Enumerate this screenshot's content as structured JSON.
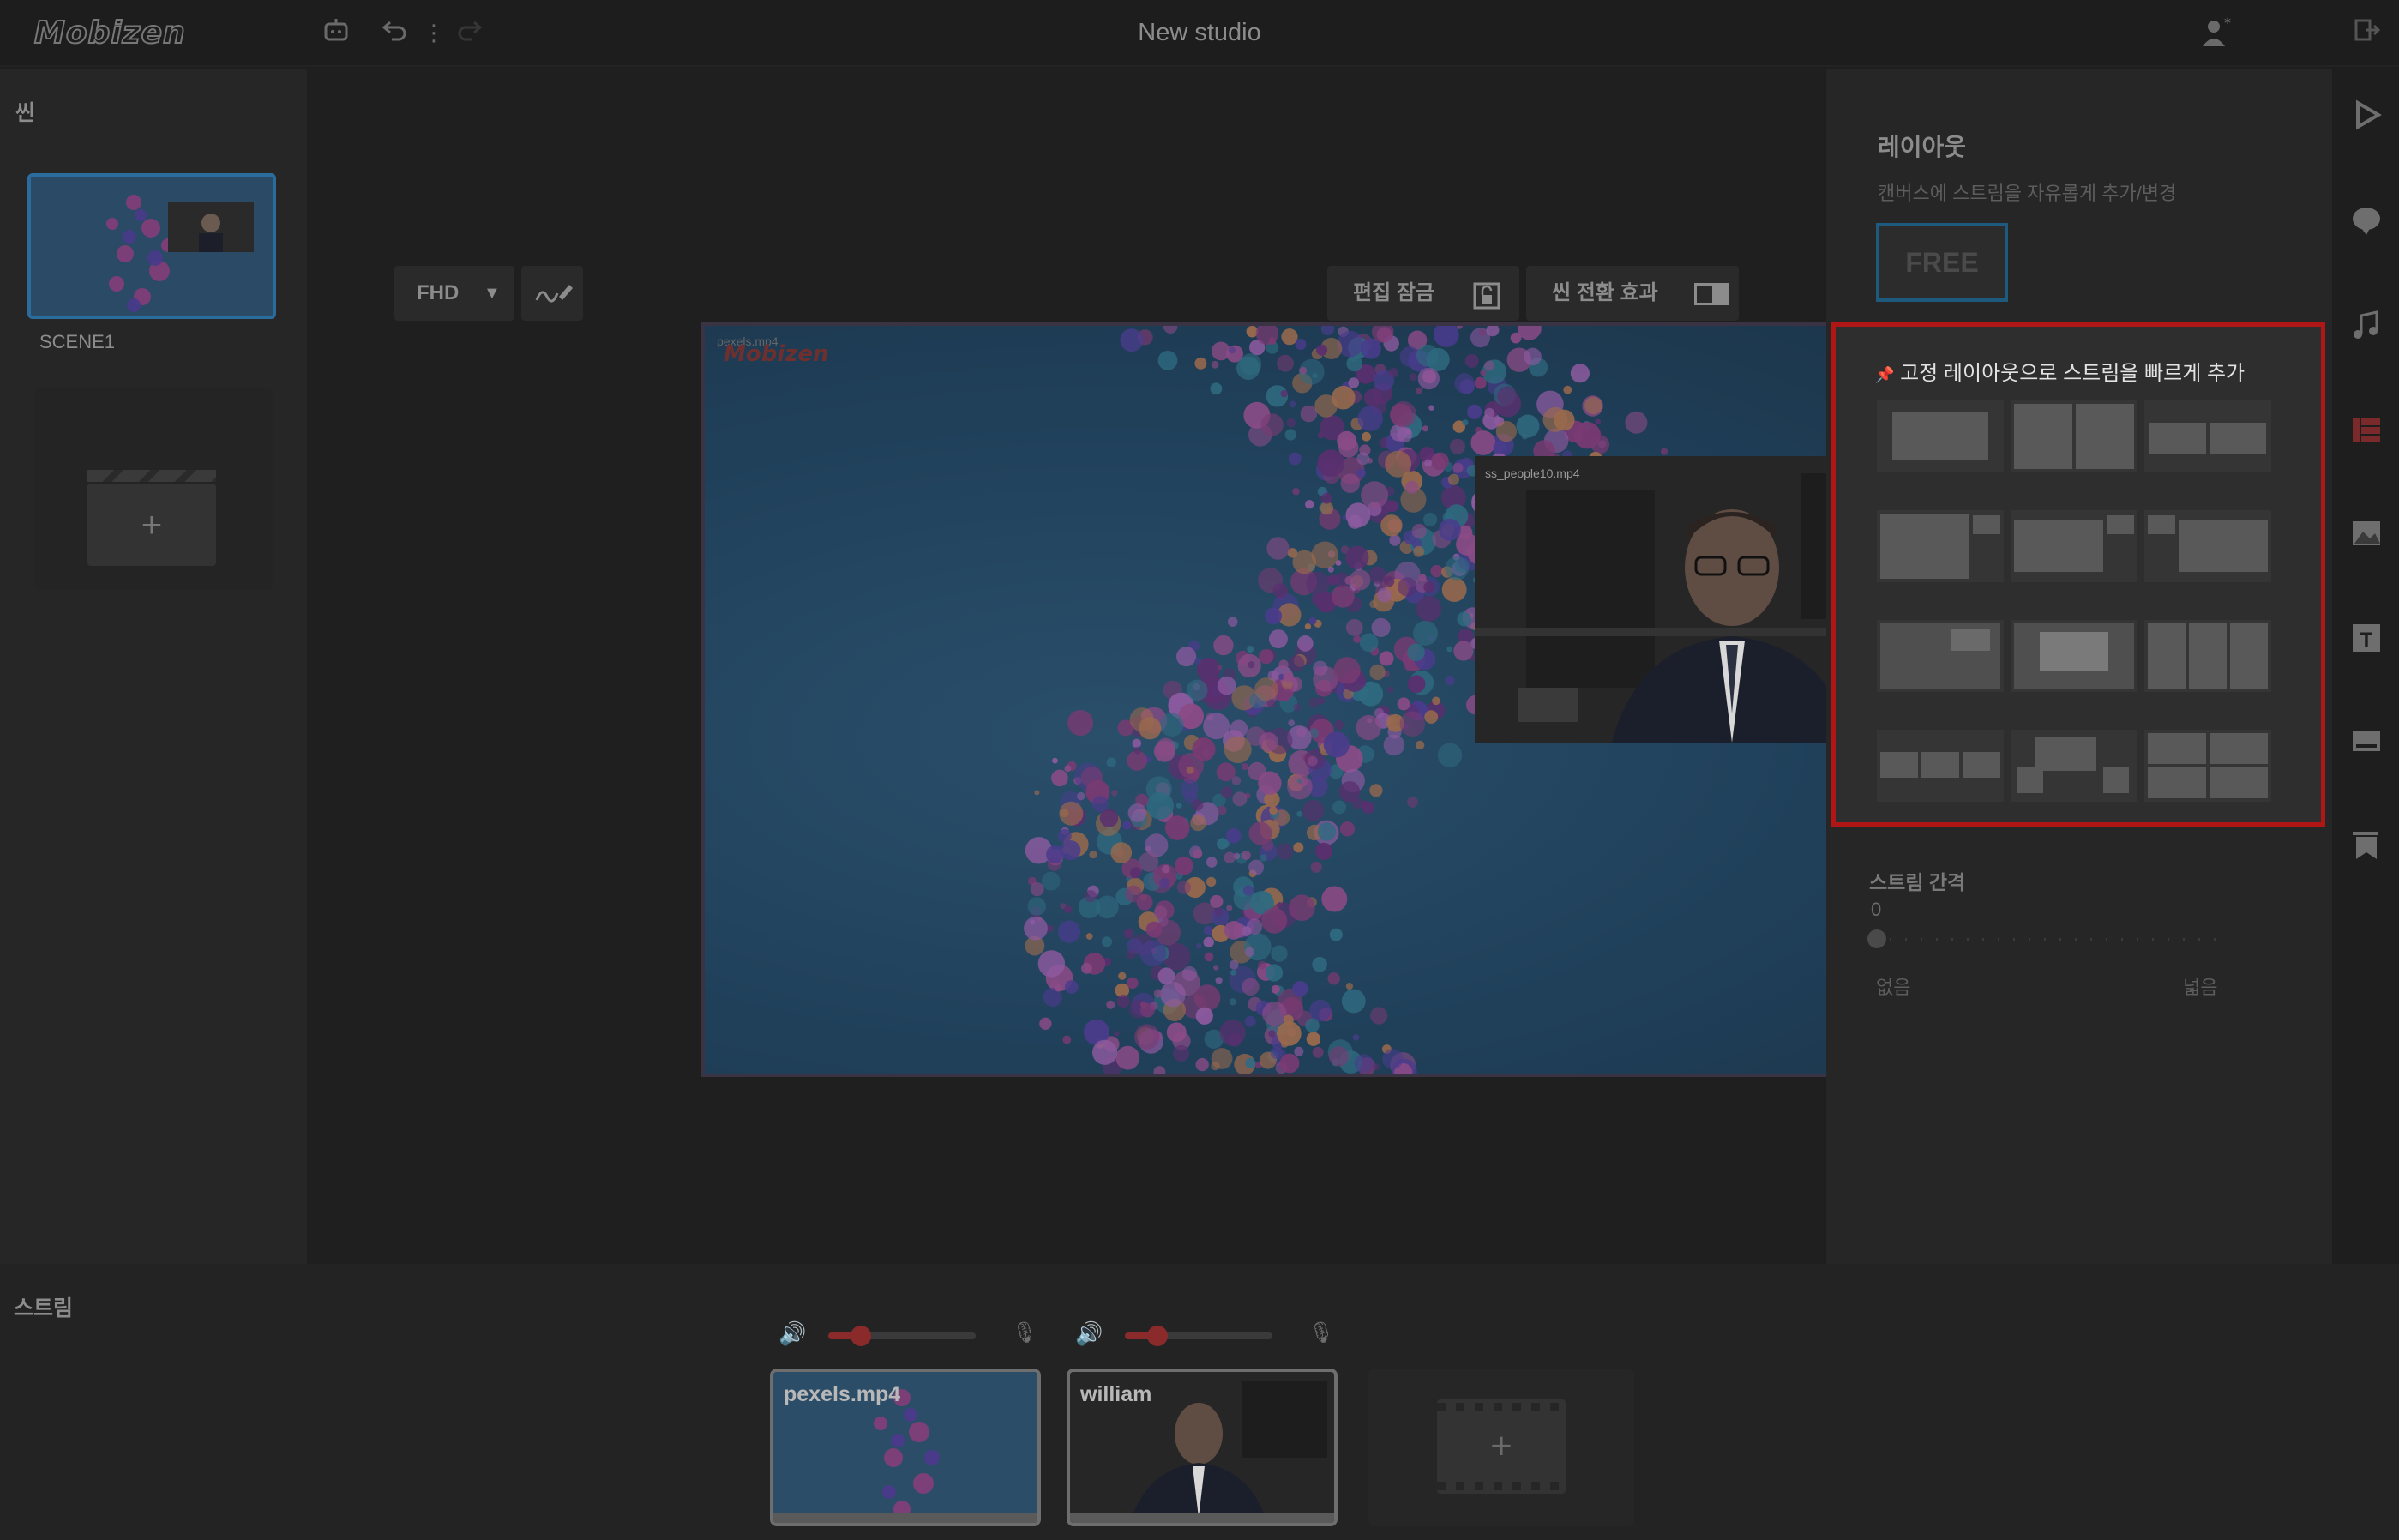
{
  "app": {
    "logo": "Mobizen",
    "title": "New studio"
  },
  "scene_panel": {
    "label": "씬",
    "scenes": [
      {
        "name": "SCENE1"
      }
    ],
    "add_label": "+"
  },
  "canvas_toolbar": {
    "resolution": "FHD",
    "lock_label": "편집 잠금",
    "transition_label": "씬 전환 효과"
  },
  "canvas": {
    "main_stream_label": "pexels.mp4",
    "overlay_logo": "Mobizen",
    "pip_label": "ss_people10.mp4"
  },
  "layout_panel": {
    "title": "레이아웃",
    "subtitle": "캔버스에 스트림을 자유롭게 추가/변경",
    "free_button": "FREE",
    "fixed_title": "고정 레이아웃으로 스트림을 빠르게 추가",
    "gap_label": "스트림 간격",
    "gap_value": "0",
    "gap_fraction": 0,
    "gap_min": "없음",
    "gap_max": "넓음"
  },
  "streams_bar": {
    "label": "스트림",
    "streams": [
      {
        "name": "pexels.mp4",
        "volume_fraction": 0.22
      },
      {
        "name": "william",
        "volume_fraction": 0.22
      }
    ],
    "add_label": "+"
  },
  "icons": {
    "undo": "undo-icon",
    "redo": "redo-icon",
    "robot": "robot-icon",
    "add_user": "add-user-icon",
    "exit": "exit-icon",
    "play": "play-icon",
    "chat": "chat-icon",
    "music": "music-icon",
    "layout": "layout-icon",
    "image": "image-icon",
    "text": "text-icon",
    "caption": "caption-icon",
    "bookmark": "bookmark-icon"
  },
  "colors": {
    "highlight_border": "#b01616",
    "accent_blue": "#1e5a7e",
    "volume_red": "#8a2a2a"
  }
}
